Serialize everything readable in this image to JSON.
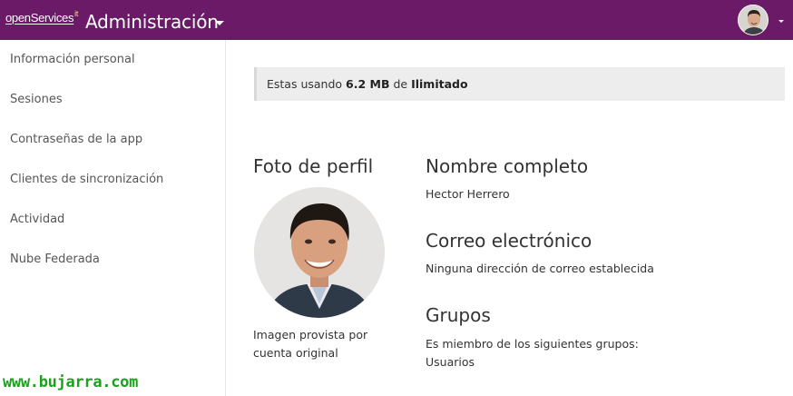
{
  "header": {
    "logo_text": "openServices",
    "logo_mark": "it",
    "app_title": "Administración",
    "colors": {
      "bar": "#6b1a67",
      "text": "#ffffff"
    }
  },
  "sidebar": {
    "items": [
      {
        "label": "Información personal"
      },
      {
        "label": "Sesiones"
      },
      {
        "label": "Contraseñas de la app"
      },
      {
        "label": "Clientes de sincronización"
      },
      {
        "label": "Actividad"
      },
      {
        "label": "Nube Federada"
      }
    ]
  },
  "quota": {
    "prefix": "Estas usando ",
    "used": "6.2 MB",
    "middle": " de ",
    "limit": "Ilimitado"
  },
  "profile": {
    "photo_title": "Foto de perfil",
    "photo_note": "Imagen provista por cuenta original",
    "fullname_title": "Nombre completo",
    "fullname_value": "Hector Herrero",
    "email_title": "Correo electrónico",
    "email_value": "Ninguna dirección de correo establecida",
    "groups_title": "Grupos",
    "groups_text": "Es miembro de los siguientes grupos:",
    "groups_value": "Usuarios"
  },
  "watermark": "www.bujarra.com"
}
